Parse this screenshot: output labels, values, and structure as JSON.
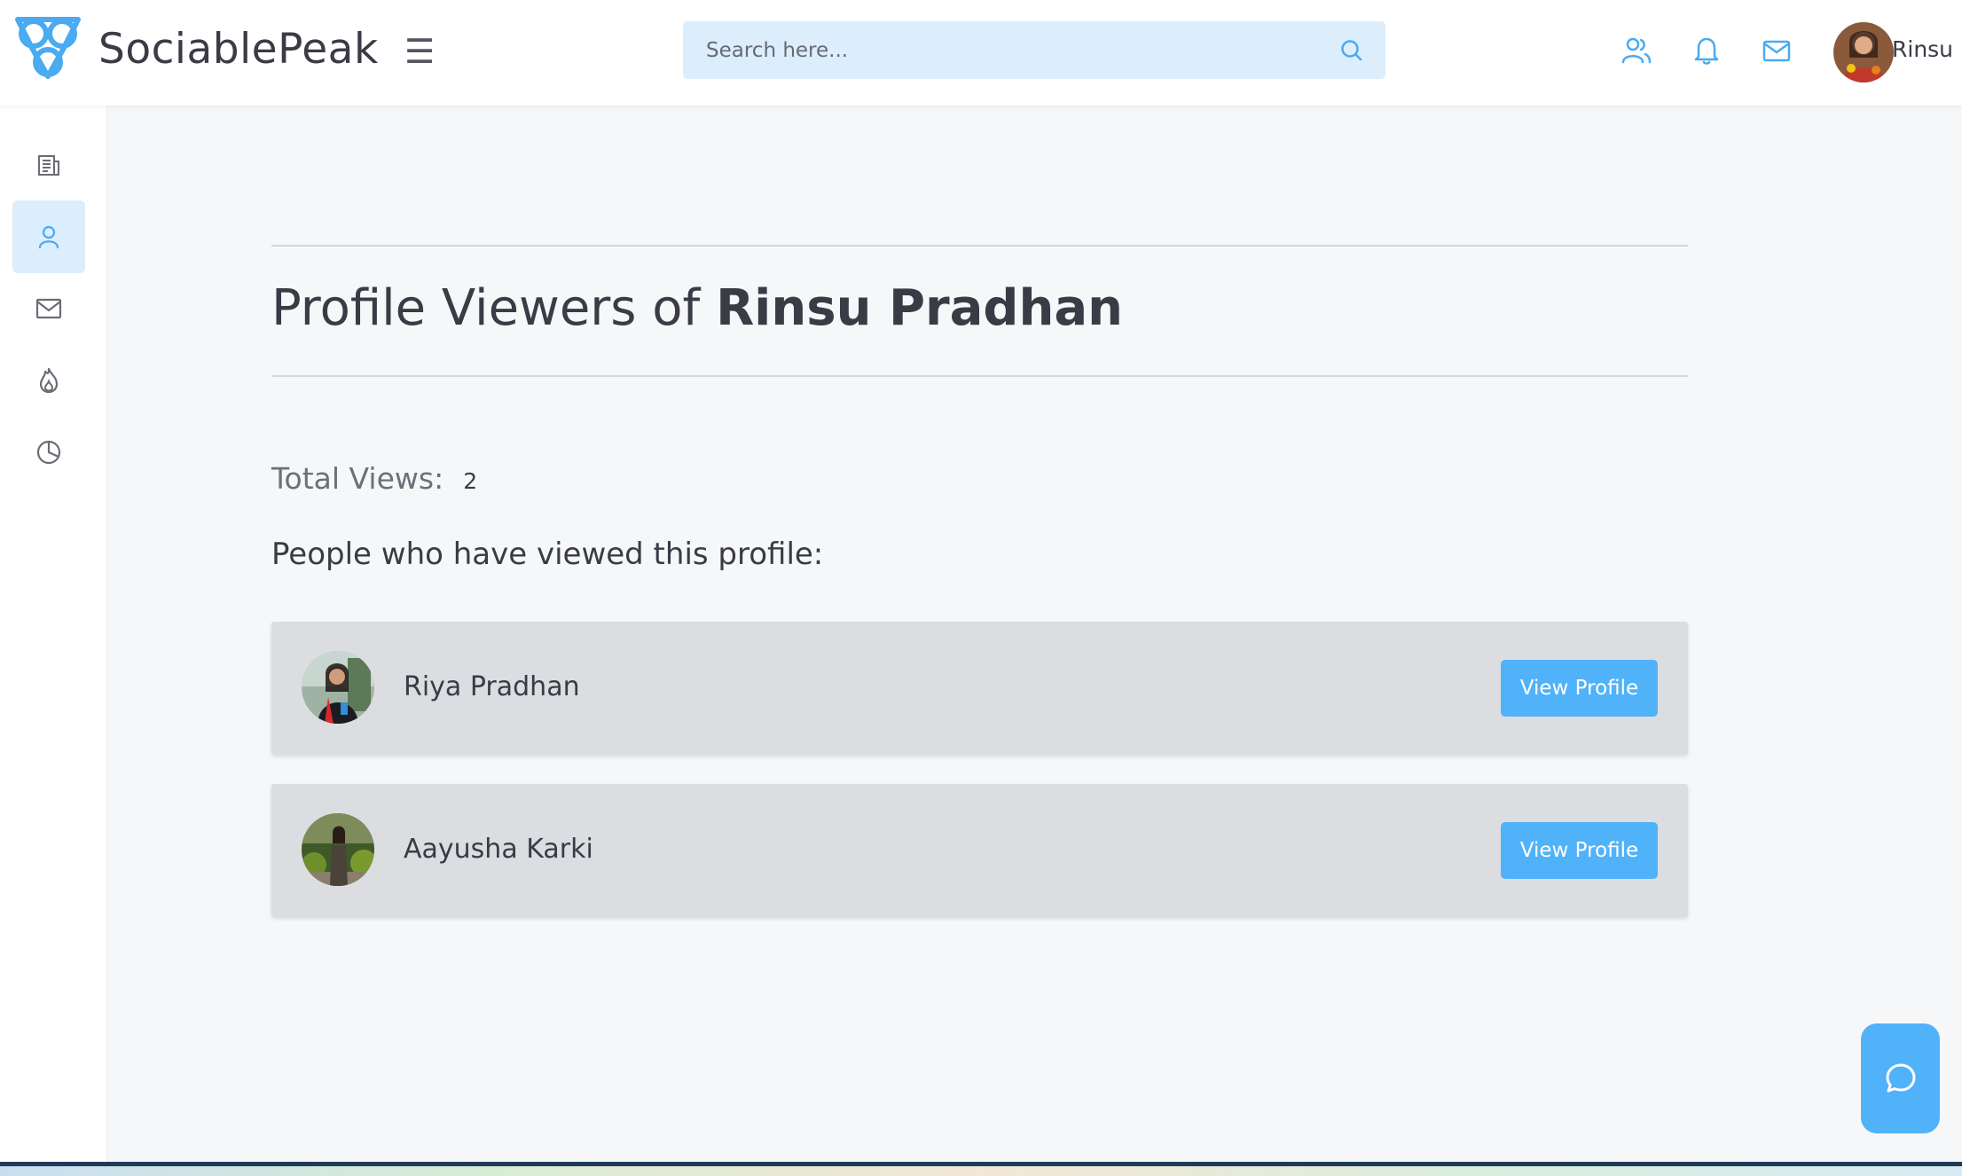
{
  "header": {
    "brand": "SociablePeak",
    "search_placeholder": "Search here...",
    "user_name": "Rinsu"
  },
  "sidebar": {
    "items": [
      {
        "name": "newspaper-icon",
        "active": false
      },
      {
        "name": "user-icon",
        "active": true
      },
      {
        "name": "envelope-icon",
        "active": false
      },
      {
        "name": "fire-icon",
        "active": false
      },
      {
        "name": "pie-chart-icon",
        "active": false
      }
    ]
  },
  "main": {
    "title_prefix": "Profile Viewers of",
    "title_name": "Rinsu Pradhan",
    "total_views_label": "Total Views:",
    "total_views_value": "2",
    "viewers_heading": "People who have viewed this profile:",
    "viewers": [
      {
        "name": "Riya Pradhan",
        "button_label": "View Profile"
      },
      {
        "name": "Aayusha Karki",
        "button_label": "View Profile"
      }
    ]
  },
  "colors": {
    "accent": "#50b2f9",
    "search_bg": "#dcedfc",
    "card_bg": "#dcdde1",
    "page_bg": "#f6f7f9"
  }
}
